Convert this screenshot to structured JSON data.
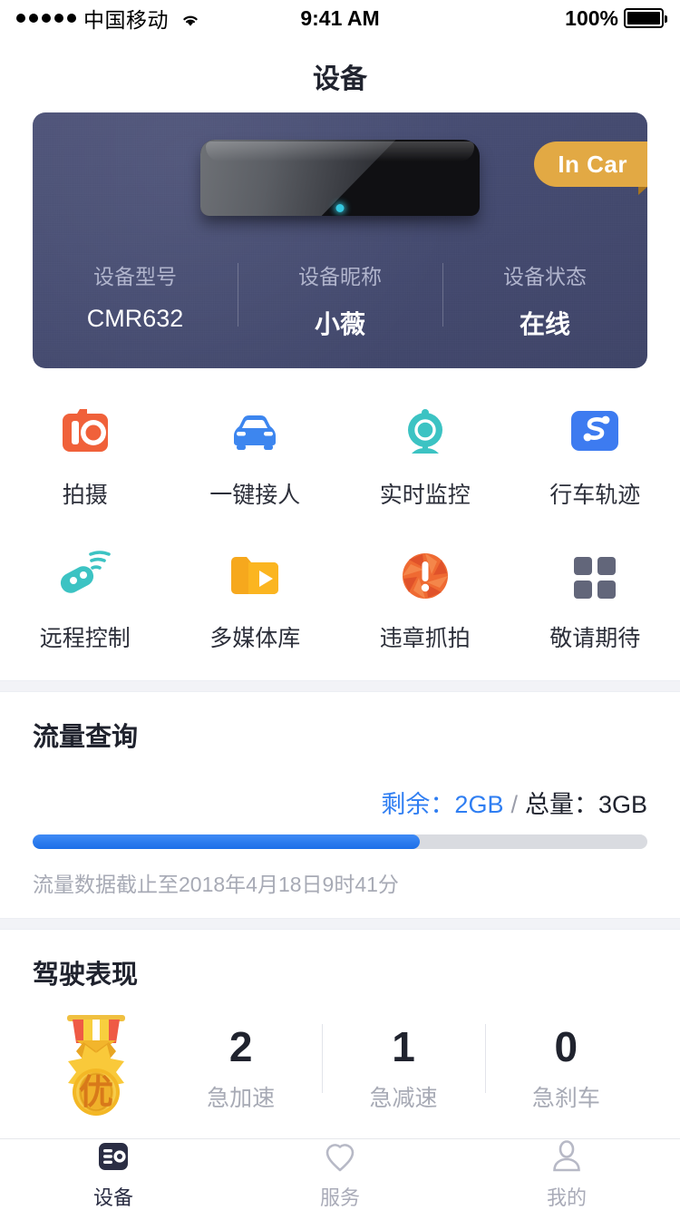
{
  "status_bar": {
    "signal_icon": "signal-dots-icon",
    "carrier": "中国移动",
    "wifi_icon": "wifi-icon",
    "time": "9:41 AM",
    "battery_percent": "100%",
    "battery_icon": "battery-full-icon"
  },
  "header": {
    "title": "设备"
  },
  "device_card": {
    "badge": "In Car",
    "device_image": "dashcam-mirror-image",
    "stats": [
      {
        "label": "设备型号",
        "value": "CMR632"
      },
      {
        "label": "设备昵称",
        "value": "小薇"
      },
      {
        "label": "设备状态",
        "value": "在线"
      }
    ]
  },
  "shortcuts": [
    {
      "label": "拍摄",
      "icon": "camera-icon"
    },
    {
      "label": "一键接人",
      "icon": "car-icon"
    },
    {
      "label": "实时监控",
      "icon": "webcam-icon"
    },
    {
      "label": "行车轨迹",
      "icon": "route-track-icon"
    },
    {
      "label": "远程控制",
      "icon": "remote-control-icon"
    },
    {
      "label": "多媒体库",
      "icon": "media-folder-icon"
    },
    {
      "label": "违章抓拍",
      "icon": "aperture-alert-icon"
    },
    {
      "label": "敬请期待",
      "icon": "grid-squares-icon"
    }
  ],
  "data_usage": {
    "title": "流量查询",
    "remaining_label": "剩余：",
    "remaining_value": "2GB",
    "divider": "/",
    "total_label": "总量：",
    "total_value": "3GB",
    "progress_percent": 63,
    "note": "流量数据截止至2018年4月18日9时41分"
  },
  "driving": {
    "title": "驾驶表现",
    "medal_icon": "gold-medal-icon",
    "medal_text": "优",
    "stats": [
      {
        "value": "2",
        "label": "急加速"
      },
      {
        "value": "1",
        "label": "急减速"
      },
      {
        "value": "0",
        "label": "急刹车"
      }
    ]
  },
  "tabbar": [
    {
      "label": "设备",
      "icon": "device-icon",
      "active": true
    },
    {
      "label": "服务",
      "icon": "heart-pin-icon",
      "active": false
    },
    {
      "label": "我的",
      "icon": "person-icon",
      "active": false
    }
  ],
  "colors": {
    "card_navy": "#464c72",
    "badge_amber": "#e2a944",
    "progress_blue": "#2f7ef2",
    "text_dark": "#20232e",
    "text_muted": "#a7aab5"
  }
}
